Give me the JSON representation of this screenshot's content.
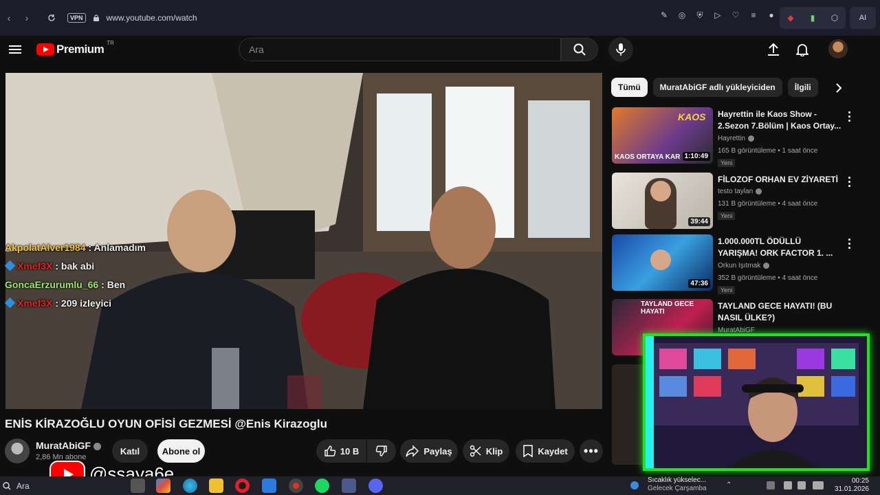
{
  "browser": {
    "url": "www.youtube.com/watch",
    "vpn_label": "VPN",
    "ai_label": "AI"
  },
  "header": {
    "logo_text": "Premium",
    "region": "TR",
    "search_placeholder": "Ara"
  },
  "chat_overlay": [
    {
      "user": "AkpolatAlver1984",
      "message": ": Anlamadım",
      "user_color": "#f5c242",
      "badge": false
    },
    {
      "user": "Xmef3X",
      "message": ": bak abi",
      "user_color": "#e02424",
      "badge": true
    },
    {
      "user": "GoncaErzurumlu_66",
      "message": ": Ben",
      "user_color": "#9ee86e",
      "badge": false
    },
    {
      "user": "Xmef3X",
      "message": ": 209 izleyici",
      "user_color": "#e02424",
      "badge": true
    }
  ],
  "video": {
    "title": "ENİS KİRAZOĞLU OYUN OFİSİ GEZMESİ @Enis Kirazoglu",
    "channel": "MuratAbiGF",
    "subscribers": "2,86 Mn abone",
    "join_label": "Katıl",
    "subscribe_label": "Abone ol",
    "likes": "10 B",
    "share_label": "Paylaş",
    "clip_label": "Klip",
    "save_label": "Kaydet"
  },
  "chips": [
    {
      "label": "Tümü",
      "active": true
    },
    {
      "label": "MuratAbiGF adlı yükleyiciden",
      "active": false
    },
    {
      "label": "İlgili",
      "active": false
    }
  ],
  "recommendations": [
    {
      "title": "Hayrettin ile Kaos Show - 2.Sezon 7.Bölüm | Kaos Ortay...",
      "channel": "Hayrettin",
      "verified": true,
      "meta": "165 B görüntüleme • 1 saat önce",
      "badge": "Yeni",
      "duration": "1:10:49",
      "thumb_caption": "KAOS ORTAYA KAR"
    },
    {
      "title": "FİLOZOF ORHAN EV ZİYARETİ",
      "channel": "testo taylan",
      "verified": true,
      "meta": "131 B görüntüleme • 4 saat önce",
      "badge": "Yeni",
      "duration": "39:44",
      "thumb_caption": ""
    },
    {
      "title": "1.000.000TL ÖDÜLLÜ YARIŞMA! ORK FACTOR 1. ...",
      "channel": "Orkun Işıtmak",
      "verified": true,
      "meta": "352 B görüntüleme • 4 saat önce",
      "badge": "Yeni",
      "duration": "47:36",
      "thumb_caption": ""
    },
    {
      "title": "TAYLAND GECE HAYATI! (BU NASIL ÜLKE?)",
      "channel": "MuratAbiGF",
      "verified": true,
      "meta": "",
      "badge": "",
      "duration": "",
      "thumb_caption": "TAYLAND GECE HAYATI"
    }
  ],
  "watermark": {
    "handle": "@ssaya6e"
  },
  "taskbar": {
    "search_label": "Ara",
    "weather_title": "Sıcaklık yükselec...",
    "weather_sub": "Gelecek Çarşamba",
    "time": "00:25",
    "date": "31.01.2026"
  },
  "colors": {
    "accent_red": "#ff0000",
    "webcam_border": "#1ee31e"
  }
}
